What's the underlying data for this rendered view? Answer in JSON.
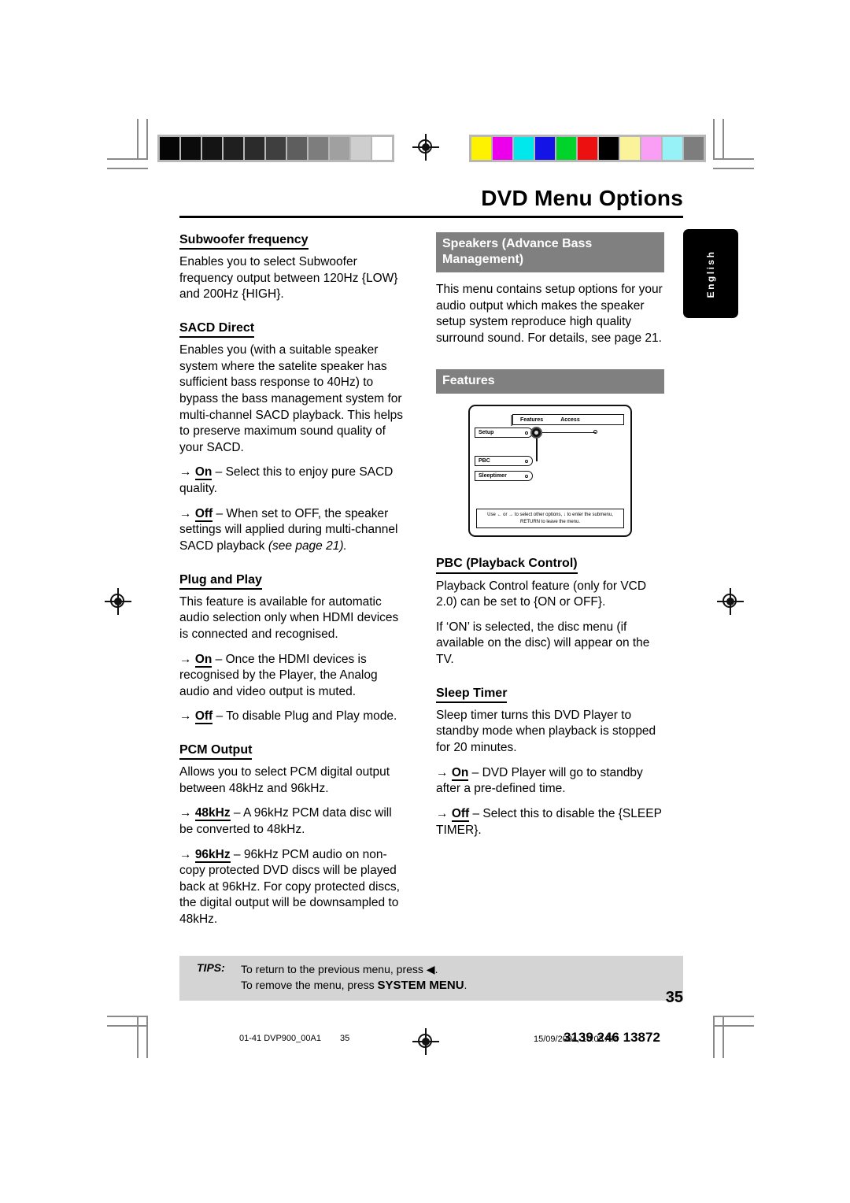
{
  "document": {
    "title": "DVD Menu Options",
    "page_number": "35",
    "language_tab": "English"
  },
  "calibration": {
    "grayscale_label": "grayscale-calibration-bar",
    "grayscale": [
      "#050505",
      "#0b0b0b",
      "#141414",
      "#1f1f1f",
      "#2b2b2b",
      "#3f3f3f",
      "#5e5e5e",
      "#7d7d7d",
      "#a0a0a0",
      "#cecece",
      "#ffffff"
    ],
    "colors": [
      "#fff200",
      "#ec00ec",
      "#00e8ec",
      "#1414e6",
      "#00d42b",
      "#ec1010",
      "#000000",
      "#fbf39a",
      "#fa9ef5",
      "#96f2f7",
      "#7d7d7d"
    ]
  },
  "left_column": {
    "sections": [
      {
        "heading": "Subwoofer frequency",
        "paragraphs": [
          "Enables you to select Subwoofer frequency output between 120Hz {LOW} and 200Hz {HIGH}."
        ],
        "options": []
      },
      {
        "heading": "SACD Direct",
        "paragraphs": [
          "Enables you (with a suitable speaker system where the satelite speaker has sufficient bass response to 40Hz) to bypass the bass management system for multi-channel SACD playback. This helps to preserve maximum sound quality of your SACD."
        ],
        "options": [
          {
            "arrow": "→",
            "term": "On",
            "dash": " – ",
            "text": "Select this to enjoy pure SACD quality.",
            "italic": ""
          },
          {
            "arrow": "→",
            "term": "Off",
            "dash": " – ",
            "text": "When set to OFF, the speaker settings will applied during multi-channel SACD playback ",
            "italic": "(see page 21)."
          }
        ]
      },
      {
        "heading": "Plug and Play",
        "paragraphs": [
          "This feature is available for automatic audio selection only when HDMI devices is connected and recognised."
        ],
        "options": [
          {
            "arrow": "→",
            "term": "On",
            "dash": " – ",
            "text": "Once the HDMI devices is recognised by the Player, the Analog audio and video output is muted.",
            "italic": ""
          },
          {
            "arrow": "→",
            "term": "Off",
            "dash": " – ",
            "text": "To disable Plug and Play mode.",
            "italic": ""
          }
        ]
      },
      {
        "heading": "PCM Output",
        "paragraphs": [
          "Allows you to select PCM digital output between 48kHz and 96kHz."
        ],
        "options": [
          {
            "arrow": "→",
            "term": "48kHz",
            "dash": " – ",
            "text": "A 96kHz PCM data disc will be converted to 48kHz.",
            "italic": ""
          },
          {
            "arrow": "→",
            "term": "96kHz",
            "dash": " – ",
            "text": "96kHz PCM audio on non-copy protected DVD discs will be played back at 96kHz. For copy protected discs, the digital output will be downsampled to 48kHz.",
            "italic": ""
          }
        ]
      }
    ]
  },
  "right_column": {
    "speakers_header": "Speakers (Advance Bass Management)",
    "speakers_body": "This menu contains setup options for your audio output which makes the speaker setup system reproduce high quality surround sound. For details, see page 21.",
    "features_header": "Features",
    "osd": {
      "columns": [
        "Features",
        "Access"
      ],
      "items": [
        "Setup",
        "PBC",
        "Sleeptimer"
      ],
      "footer_line1": "Use ← or → to select other options, ↓ to enter the submenu,",
      "footer_line2": "RETURN to leave the menu."
    },
    "sections": [
      {
        "heading_strong": "PBC",
        "heading_rest": " (Playback Control)",
        "paragraphs": [
          "Playback Control feature (only for VCD 2.0) can be set to {ON or OFF}.",
          "If ‘ON’ is selected, the disc menu (if available on the disc) will appear on the TV."
        ],
        "options": []
      },
      {
        "heading_strong": "Sleep Timer",
        "heading_rest": "",
        "paragraphs": [
          "Sleep timer turns this DVD Player to standby mode when playback is stopped for 20 minutes."
        ],
        "options": [
          {
            "arrow": "→",
            "term": "On",
            "dash": " – ",
            "text": "DVD Player will go to standby after a pre-defined time.",
            "italic": ""
          },
          {
            "arrow": "→",
            "term": "Off",
            "dash": " – ",
            "text": "Select this to disable the {SLEEP TIMER}.",
            "italic": ""
          }
        ]
      }
    ]
  },
  "tips": {
    "label": "TIPS:",
    "line1_pre": "To return to the previous menu, press ",
    "line1_glyph": "◀",
    "line1_post": ".",
    "line2_pre": "To remove the menu, press ",
    "line2_strong": "SYSTEM MENU",
    "line2_post": "."
  },
  "print_footer": {
    "file": "01-41 DVP900_00A1",
    "page": "35",
    "date": "15/09/2004, 10:03 AM",
    "part_number": "3139 246 13872"
  }
}
